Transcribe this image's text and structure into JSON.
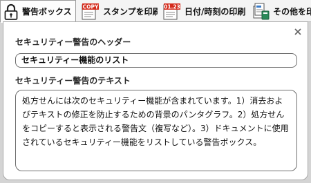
{
  "tabs": [
    {
      "label": "警告ボックス",
      "icon": "lock-icon",
      "active": true
    },
    {
      "label": "スタンプを印刷",
      "icon": "stamp-icon",
      "icon_text": "COPY",
      "active": false
    },
    {
      "label": "日付/時刻の印刷",
      "icon": "date-time-icon",
      "icon_text": "01.23",
      "active": false
    },
    {
      "label": "その他を印刷",
      "icon": "print-other-icon",
      "active": false
    }
  ],
  "panel": {
    "header_label": "セキュリティー警告のヘッダー",
    "header_value": "セキュリティー機能のリスト",
    "text_label": "セキュリティー警告のテキスト",
    "text_value": "処方せんには次のセキュリティー機能が含まれています。1）消去およびテキストの修正を防止するための背景のパンタグラフ。2）処方せんをコピーすると表示される警告文（複写など）。3）ドキュメントに使用されているセキュリティー機能をリストしている警告ボックス。"
  },
  "colors": {
    "stamp_red": "#d42a1a",
    "accent_blue": "#3a7bc8"
  }
}
